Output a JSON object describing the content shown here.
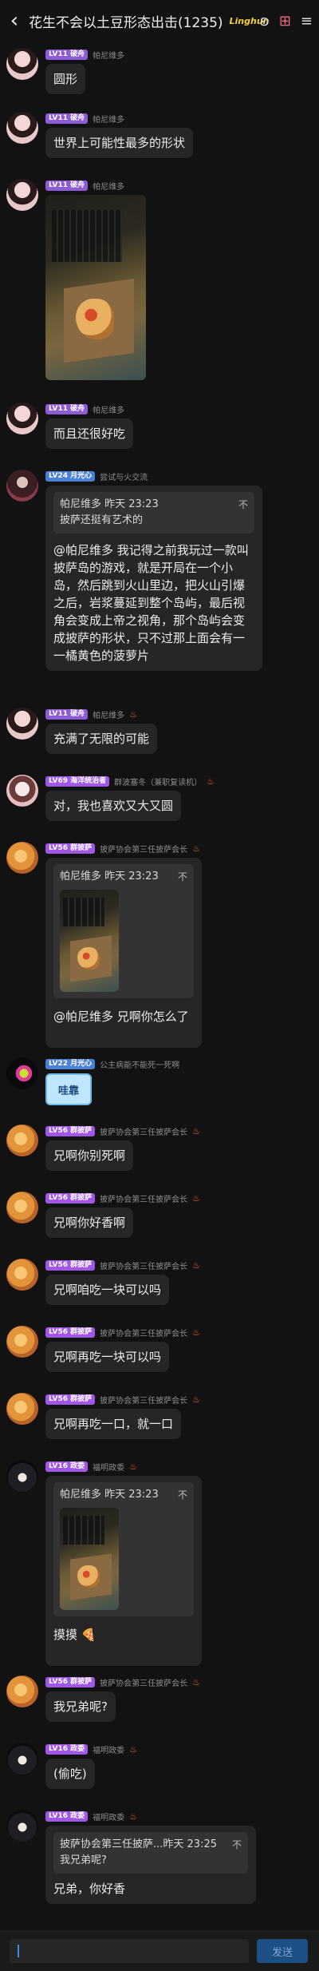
{
  "header": {
    "back_icon": "‹",
    "title": "花生不会以土豆形态出击(1235)",
    "badge": "Linghun"
  },
  "messages": [
    {
      "level": "LV11",
      "tag": "破舟",
      "name": "帕尼维多",
      "text": "圆形"
    },
    {
      "level": "LV11",
      "tag": "破舟",
      "name": "帕尼维多",
      "text": "世界上可能性最多的形状"
    },
    {
      "level": "LV11",
      "tag": "破舟",
      "name": "帕尼维多"
    },
    {
      "level": "LV11",
      "tag": "破舟",
      "name": "帕尼维多",
      "text": "而且还很好吃"
    },
    {
      "level": "LV24",
      "tag": "月光心",
      "name": "尝试与火交流",
      "quote_head": "帕尼维多 昨天 23:23",
      "quote_body": "披萨还挺有艺术的",
      "text": "@帕尼维多 我记得之前我玩过一款叫披萨岛的游戏，就是开局在一个小岛，然后跳到火山里边，把火山引爆之后，岩浆蔓延到整个岛屿，最后视角会变成上帝之视角，那个岛屿会变成披萨的形状，只不过那上面会有一一橘黄色的菠萝片"
    },
    {
      "level": "LV11",
      "tag": "破舟",
      "name": "帕尼维多",
      "text": "充满了无限的可能"
    },
    {
      "level": "LV69",
      "tag": "海洋统治者",
      "name": "群波塞冬（兼职复读机）",
      "text": "对，我也喜欢又大又圆"
    },
    {
      "level": "LV56",
      "tag": "群披萨",
      "name": "披萨协会第三任披萨会长",
      "quote_head": "帕尼维多 昨天 23:23",
      "text": "@帕尼维多 兄啊你怎么了"
    },
    {
      "level": "LV22",
      "tag": "月光心",
      "name": "公主病能不能死一死啊",
      "sticker": "哇靠"
    },
    {
      "level": "LV56",
      "tag": "群披萨",
      "name": "披萨协会第三任披萨会长",
      "text": "兄啊你别死啊"
    },
    {
      "level": "LV56",
      "tag": "群披萨",
      "name": "披萨协会第三任披萨会长",
      "text": "兄啊你好香啊"
    },
    {
      "level": "LV56",
      "tag": "群披萨",
      "name": "披萨协会第三任披萨会长",
      "text": "兄啊咱吃一块可以吗"
    },
    {
      "level": "LV56",
      "tag": "群披萨",
      "name": "披萨协会第三任披萨会长",
      "text": "兄啊再吃一块可以吗"
    },
    {
      "level": "LV56",
      "tag": "群披萨",
      "name": "披萨协会第三任披萨会长",
      "text": "兄啊再吃一口，就一口"
    },
    {
      "level": "LV16",
      "tag": "政委",
      "name": "福明政委",
      "quote_head": "帕尼维多 昨天 23:23",
      "text": "摸摸 🍕"
    },
    {
      "level": "LV56",
      "tag": "群披萨",
      "name": "披萨协会第三任披萨会长",
      "text": "我兄弟呢?"
    },
    {
      "level": "LV16",
      "tag": "政委",
      "name": "福明政委",
      "text": "(偷吃)"
    },
    {
      "level": "LV16",
      "tag": "政委",
      "name": "福明政委",
      "quote_head": "披萨协会第三任披萨...昨天 23:25",
      "quote_body": "我兄弟呢?",
      "text": "兄弟，你好香"
    }
  ],
  "input": {
    "send_label": "发送"
  },
  "colors": {
    "lv_purple": "#8e5bd6",
    "lv_violet": "#a056e6",
    "lv_blue": "#4a7fd6",
    "send": "#1c4f86",
    "accent": "#3a8ee6"
  }
}
